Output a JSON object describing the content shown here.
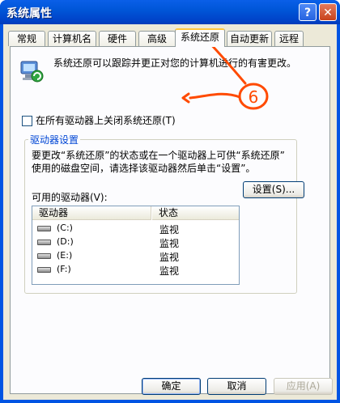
{
  "window": {
    "title": "系统属性",
    "help_label": "?",
    "close_label": "✕"
  },
  "tabs": [
    {
      "label": "常规"
    },
    {
      "label": "计算机名"
    },
    {
      "label": "硬件"
    },
    {
      "label": "高级"
    },
    {
      "label": "系统还原",
      "active": true
    },
    {
      "label": "自动更新"
    },
    {
      "label": "远程"
    }
  ],
  "system_restore": {
    "intro": "系统还原可以跟踪并更正对您的计算机进行的有害更改。",
    "disable_all_label": "在所有驱动器上关闭系统还原(T)",
    "disable_all_checked": false,
    "group_title": "驱动器设置",
    "group_desc_line1": "要更改“系统还原”的状态或在一个驱动器上可供“系统还原”",
    "group_desc_line2": "使用的磁盘空间，请选择该驱动器然后单击“设置”。",
    "drives_label": "可用的驱动器(V):",
    "columns": [
      "驱动器",
      "状态"
    ],
    "drives": [
      {
        "name": "(C:)",
        "status": "监视"
      },
      {
        "name": "(D:)",
        "status": "监视"
      },
      {
        "name": "(E:)",
        "status": "监视"
      },
      {
        "name": "(F:)",
        "status": "监视"
      }
    ],
    "settings_button": "设置(S)..."
  },
  "annotation": {
    "number": "6",
    "color": "#ff4a00"
  },
  "footer": {
    "ok": "确定",
    "cancel": "取消",
    "apply": "应用(A)"
  }
}
